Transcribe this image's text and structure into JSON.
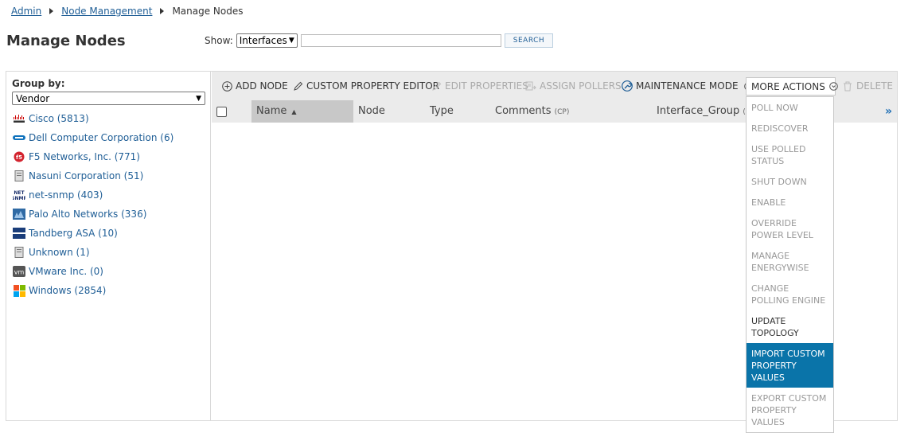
{
  "breadcrumb": {
    "items": [
      "Admin",
      "Node Management"
    ],
    "current": "Manage Nodes"
  },
  "page_title": "Manage Nodes",
  "show_bar": {
    "label": "Show:",
    "selected": "Interfaces",
    "search_value": "",
    "search_button": "SEARCH"
  },
  "left_panel": {
    "group_by_label": "Group by:",
    "group_by_value": "Vendor",
    "vendors": [
      {
        "label": "Cisco (5813)",
        "icon": "cisco-icon"
      },
      {
        "label": "Dell Computer Corporation (6)",
        "icon": "dell-icon"
      },
      {
        "label": "F5 Networks, Inc. (771)",
        "icon": "f5-icon"
      },
      {
        "label": "Nasuni Corporation (51)",
        "icon": "server-icon"
      },
      {
        "label": "net-snmp (403)",
        "icon": "net-snmp-icon"
      },
      {
        "label": "Palo Alto Networks (336)",
        "icon": "palo-alto-icon"
      },
      {
        "label": "Tandberg ASA (10)",
        "icon": "tandberg-icon"
      },
      {
        "label": "Unknown (1)",
        "icon": "server-icon"
      },
      {
        "label": "VMware Inc. (0)",
        "icon": "vmware-icon"
      },
      {
        "label": "Windows (2854)",
        "icon": "windows-icon"
      }
    ]
  },
  "toolbar": {
    "add_node": "ADD NODE",
    "custom_property_editor": "CUSTOM PROPERTY EDITOR",
    "edit_properties": "EDIT PROPERTIES",
    "assign_pollers": "ASSIGN POLLERS",
    "maintenance_mode": "MAINTENANCE MODE",
    "more_actions": "MORE ACTIONS",
    "delete": "DELETE"
  },
  "columns": {
    "name": "Name",
    "node": "Node",
    "type": "Type",
    "comments": "Comments",
    "comments_suffix": "(CP)",
    "interface_group": "Interface_Group",
    "interface_group_suffix": "(C"
  },
  "more_actions_menu": [
    {
      "label": "POLL NOW",
      "state": "disabled"
    },
    {
      "label": "REDISCOVER",
      "state": "disabled"
    },
    {
      "label": "USE POLLED STATUS",
      "state": "disabled"
    },
    {
      "label": "SHUT DOWN",
      "state": "disabled"
    },
    {
      "label": "ENABLE",
      "state": "disabled"
    },
    {
      "label": "OVERRIDE POWER LEVEL",
      "state": "disabled"
    },
    {
      "label": "MANAGE ENERGYWISE",
      "state": "disabled"
    },
    {
      "label": "CHANGE POLLING ENGINE",
      "state": "disabled"
    },
    {
      "label": "UPDATE TOPOLOGY",
      "state": "enabled"
    },
    {
      "label": "IMPORT CUSTOM PROPERTY VALUES",
      "state": "active"
    },
    {
      "label": "EXPORT CUSTOM PROPERTY VALUES",
      "state": "disabled"
    }
  ],
  "colors": {
    "link": "#1f5e96",
    "accent": "#0a74a9",
    "toolbar_bg": "#ebebeb",
    "disabled_text": "#999999"
  }
}
